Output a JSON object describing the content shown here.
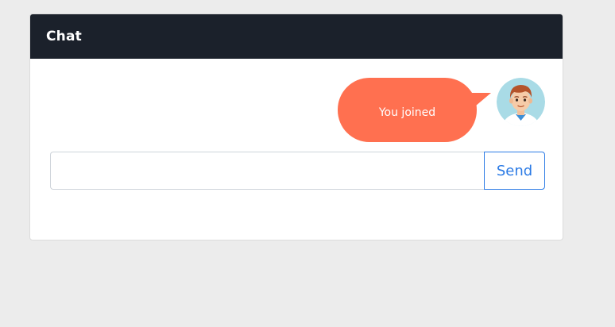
{
  "chat": {
    "title": "Chat",
    "messages": [
      {
        "text": "You joined",
        "avatar": "user-avatar-icon"
      }
    ],
    "input": {
      "value": "",
      "placeholder": ""
    },
    "send_label": "Send"
  },
  "colors": {
    "page_background": "#ececec",
    "header_background": "#1b212b",
    "bubble": "#ff7050",
    "accent": "#2c7be5"
  }
}
